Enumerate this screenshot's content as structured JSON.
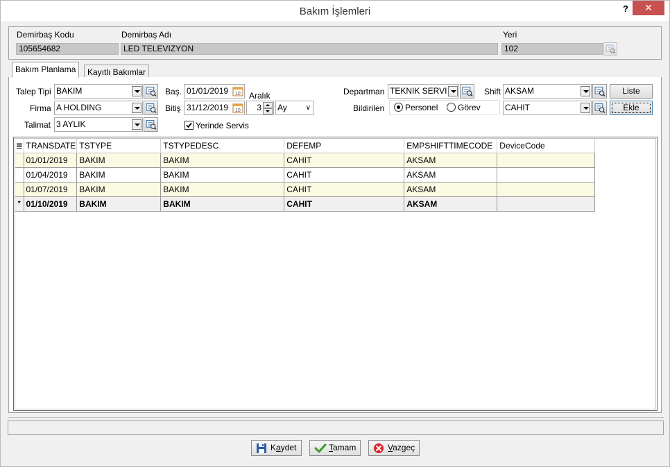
{
  "window": {
    "title": "Bakım İşlemleri",
    "help": "?",
    "close": "✕"
  },
  "header": {
    "code_label": "Demirbaş Kodu",
    "code_value": "105654682",
    "name_label": "Demirbaş Adı",
    "name_value": "LED TELEVIZYON",
    "location_label": "Yeri",
    "location_value": "102"
  },
  "tabs": [
    {
      "label": "Bakım Planlama"
    },
    {
      "label": "Kayıtlı Bakımlar"
    }
  ],
  "form": {
    "talep_tipi_label": "Talep Tipi",
    "talep_tipi_value": "BAKIM",
    "firma_label": "Firma",
    "firma_value": "A HOLDING",
    "talimat_label": "Talimat",
    "talimat_value": "3 AYLIK",
    "bas_label": "Baş.",
    "bas_value": "01/01/2019",
    "bitis_label": "Bitiş",
    "bitis_value": "31/12/2019",
    "aralik_label": "Aralık",
    "aralik_value": "3",
    "aralik_unit": "Ay",
    "yerinde_servis_label": "Yerinde Servis",
    "departman_label": "Departman",
    "departman_value": "TEKNIK SERVI",
    "bildirilen_label": "Bildirilen",
    "personel_label": "Personel",
    "gorev_label": "Görev",
    "shift_label": "Shift",
    "shift_value": "AKSAM",
    "person_value": "CAHIT",
    "liste_button": "Liste",
    "ekle_button": "Ekle"
  },
  "grid": {
    "columns": [
      "TRANSDATE",
      "TSTYPE",
      "TSTYPEDESC",
      "DEFEMP",
      "EMPSHIFTTIMECODE",
      "DeviceCode"
    ],
    "header_indicator": "≣",
    "new_row_indicator": "*",
    "rows": [
      {
        "cells": [
          "01/01/2019",
          "BAKIM",
          "BAKIM",
          "CAHIT",
          "AKSAM",
          ""
        ]
      },
      {
        "cells": [
          "01/04/2019",
          "BAKIM",
          "BAKIM",
          "CAHIT",
          "AKSAM",
          ""
        ]
      },
      {
        "cells": [
          "01/07/2019",
          "BAKIM",
          "BAKIM",
          "CAHIT",
          "AKSAM",
          ""
        ]
      },
      {
        "cells": [
          "01/10/2019",
          "BAKIM",
          "BAKIM",
          "CAHIT",
          "AKSAM",
          ""
        ]
      }
    ]
  },
  "buttons": {
    "save_pre": "K",
    "save_u": "a",
    "save_post": "ydet",
    "ok_pre": "",
    "ok_u": "T",
    "ok_post": "amam",
    "cancel_pre": "",
    "cancel_u": "V",
    "cancel_post": "azgeç"
  },
  "colors": {
    "close_bg": "#c75050",
    "row_alt": "#fbfbe4",
    "ro_field": "#c8c8c8"
  }
}
